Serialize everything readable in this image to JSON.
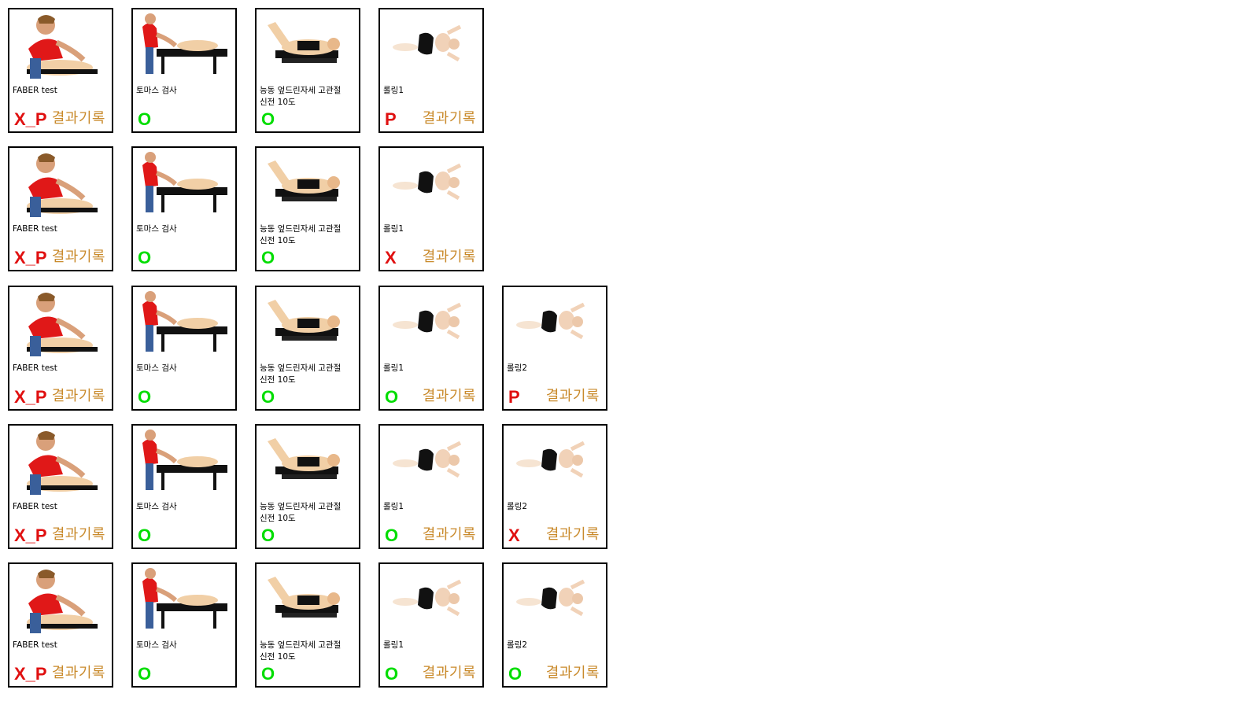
{
  "colors": {
    "result_red": "#e01010",
    "result_green": "#00dd00",
    "record_gold": "#c98a2b",
    "border": "#000000"
  },
  "rows": [
    {
      "cards": [
        {
          "image": "faber-exam-photo",
          "label": "FABER test",
          "result": "X_P",
          "result_color": "#e01010",
          "record": "결과기록"
        },
        {
          "image": "thomas-test-photo",
          "label": "토마스 검사",
          "result": "O",
          "result_color": "#00dd00",
          "record": ""
        },
        {
          "image": "prone-hip-extension-photo",
          "label": "능동 엎드린자세 고관절\n신전 10도",
          "result": "O",
          "result_color": "#00dd00",
          "record": ""
        },
        {
          "image": "rolling-photo",
          "label": "롤링1",
          "result": "P",
          "result_color": "#e01010",
          "record": "결과기록"
        }
      ]
    },
    {
      "cards": [
        {
          "image": "faber-exam-photo",
          "label": "FABER test",
          "result": "X_P",
          "result_color": "#e01010",
          "record": "결과기록"
        },
        {
          "image": "thomas-test-photo",
          "label": "토마스 검사",
          "result": "O",
          "result_color": "#00dd00",
          "record": ""
        },
        {
          "image": "prone-hip-extension-photo",
          "label": "능동 엎드린자세 고관절\n신전 10도",
          "result": "O",
          "result_color": "#00dd00",
          "record": ""
        },
        {
          "image": "rolling-photo",
          "label": "롤링1",
          "result": "X",
          "result_color": "#e01010",
          "record": "결과기록"
        }
      ]
    },
    {
      "cards": [
        {
          "image": "faber-exam-photo",
          "label": "FABER test",
          "result": "X_P",
          "result_color": "#e01010",
          "record": "결과기록"
        },
        {
          "image": "thomas-test-photo",
          "label": "토마스 검사",
          "result": "O",
          "result_color": "#00dd00",
          "record": ""
        },
        {
          "image": "prone-hip-extension-photo",
          "label": "능동 엎드린자세 고관절\n신전 10도",
          "result": "O",
          "result_color": "#00dd00",
          "record": ""
        },
        {
          "image": "rolling-photo",
          "label": "롤링1",
          "result": "O",
          "result_color": "#00dd00",
          "record": "결과기록"
        },
        {
          "image": "rolling-photo",
          "label": "롤링2",
          "result": "P",
          "result_color": "#e01010",
          "record": "결과기록"
        }
      ]
    },
    {
      "cards": [
        {
          "image": "faber-exam-photo",
          "label": "FABER test",
          "result": "X_P",
          "result_color": "#e01010",
          "record": "결과기록"
        },
        {
          "image": "thomas-test-photo",
          "label": "토마스 검사",
          "result": "O",
          "result_color": "#00dd00",
          "record": ""
        },
        {
          "image": "prone-hip-extension-photo",
          "label": "능동 엎드린자세 고관절\n신전 10도",
          "result": "O",
          "result_color": "#00dd00",
          "record": ""
        },
        {
          "image": "rolling-photo",
          "label": "롤링1",
          "result": "O",
          "result_color": "#00dd00",
          "record": "결과기록"
        },
        {
          "image": "rolling-photo",
          "label": "롤링2",
          "result": "X",
          "result_color": "#e01010",
          "record": "결과기록"
        }
      ]
    },
    {
      "cards": [
        {
          "image": "faber-exam-photo",
          "label": "FABER test",
          "result": "X_P",
          "result_color": "#e01010",
          "record": "결과기록"
        },
        {
          "image": "thomas-test-photo",
          "label": "토마스 검사",
          "result": "O",
          "result_color": "#00dd00",
          "record": ""
        },
        {
          "image": "prone-hip-extension-photo",
          "label": "능동 엎드린자세 고관절\n신전 10도",
          "result": "O",
          "result_color": "#00dd00",
          "record": ""
        },
        {
          "image": "rolling-photo",
          "label": "롤링1",
          "result": "O",
          "result_color": "#00dd00",
          "record": "결과기록"
        },
        {
          "image": "rolling-photo",
          "label": "롤링2",
          "result": "O",
          "result_color": "#00dd00",
          "record": "결과기록"
        }
      ]
    }
  ]
}
